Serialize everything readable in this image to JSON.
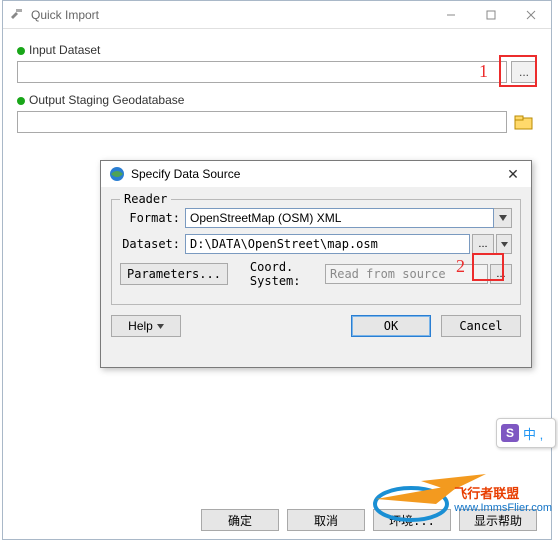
{
  "quick_import": {
    "title": "Quick Import",
    "input_label": "Input Dataset",
    "input_value": "",
    "output_label": "Output Staging Geodatabase",
    "output_value": "",
    "buttons": {
      "ok": "确定",
      "cancel": "取消",
      "env": "环境...",
      "help": "显示帮助"
    }
  },
  "annotations": {
    "one": "1",
    "two": "2"
  },
  "data_source": {
    "title": "Specify Data Source",
    "group": "Reader",
    "format_label": "Format:",
    "format_value": "OpenStreetMap (OSM) XML",
    "dataset_label": "Dataset:",
    "dataset_value": "D:\\DATA\\OpenStreet\\map.osm",
    "params_btn": "Parameters...",
    "coord_label": "Coord. System:",
    "coord_value": "Read from source",
    "help": "Help",
    "ok": "OK",
    "cancel": "Cancel"
  },
  "ime": {
    "logo": "S",
    "mode": "中 ,"
  },
  "watermark": {
    "line1": "飞行者联盟",
    "line2": "www.ImmsFlier.com"
  }
}
